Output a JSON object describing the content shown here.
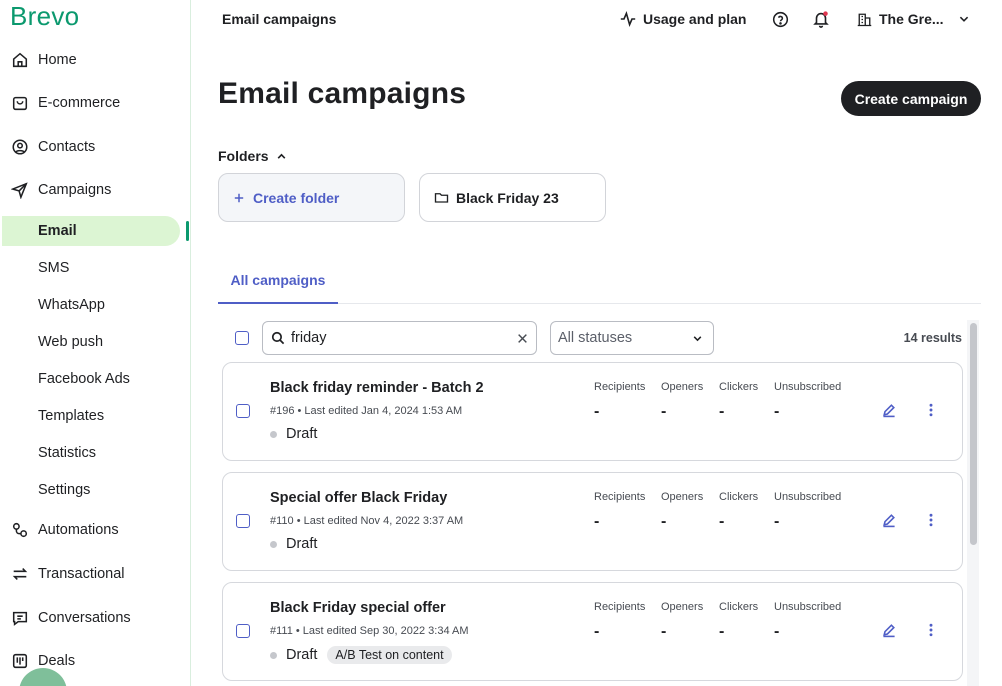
{
  "sidebar": {
    "logo": "Brevo",
    "items": [
      {
        "label": "Home",
        "icon": "home-icon"
      },
      {
        "label": "E-commerce",
        "icon": "shopping-bag-icon"
      },
      {
        "label": "Contacts",
        "icon": "contact-icon"
      },
      {
        "label": "Campaigns",
        "icon": "send-icon"
      }
    ],
    "campaign_sub": [
      "Email",
      "SMS",
      "WhatsApp",
      "Web push",
      "Facebook Ads",
      "Templates",
      "Statistics",
      "Settings"
    ],
    "bottom_items": [
      {
        "label": "Automations",
        "icon": "automation-icon"
      },
      {
        "label": "Transactional",
        "icon": "transactional-icon"
      },
      {
        "label": "Conversations",
        "icon": "chat-icon"
      },
      {
        "label": "Deals",
        "icon": "deals-icon"
      }
    ]
  },
  "header": {
    "title": "Email campaigns",
    "usage_label": "Usage and plan",
    "account_label": "The Gre..."
  },
  "main": {
    "title": "Email campaigns",
    "create_button": "Create campaign",
    "folders_label": "Folders",
    "create_folder": "Create folder",
    "folder_name": "Black Friday 23",
    "tab_label": "All campaigns",
    "search_value": "friday",
    "status_filter": "All statuses",
    "results": "14 results"
  },
  "stat_headers": [
    "Recipients",
    "Openers",
    "Clickers",
    "Unsubscribed"
  ],
  "campaigns": [
    {
      "name": "Black friday reminder - Batch 2",
      "meta": "#196 • Last edited Jan 4, 2024 1:53 AM",
      "status": "Draft",
      "tag": "",
      "stats": [
        "-",
        "-",
        "-",
        "-"
      ]
    },
    {
      "name": "Special offer Black Friday",
      "meta": "#110 • Last edited Nov 4, 2022 3:37 AM",
      "status": "Draft",
      "tag": "",
      "stats": [
        "-",
        "-",
        "-",
        "-"
      ]
    },
    {
      "name": "Black Friday special offer",
      "meta": "#111 • Last edited Sep 30, 2022 3:34 AM",
      "status": "Draft",
      "tag": "A/B Test on content",
      "stats": [
        "-",
        "-",
        "-",
        "-"
      ]
    }
  ],
  "colors": {
    "brand": "#0b996e",
    "accent": "#4f5ec6",
    "active_bg": "#dcf5d3",
    "dark": "#1f2023"
  }
}
